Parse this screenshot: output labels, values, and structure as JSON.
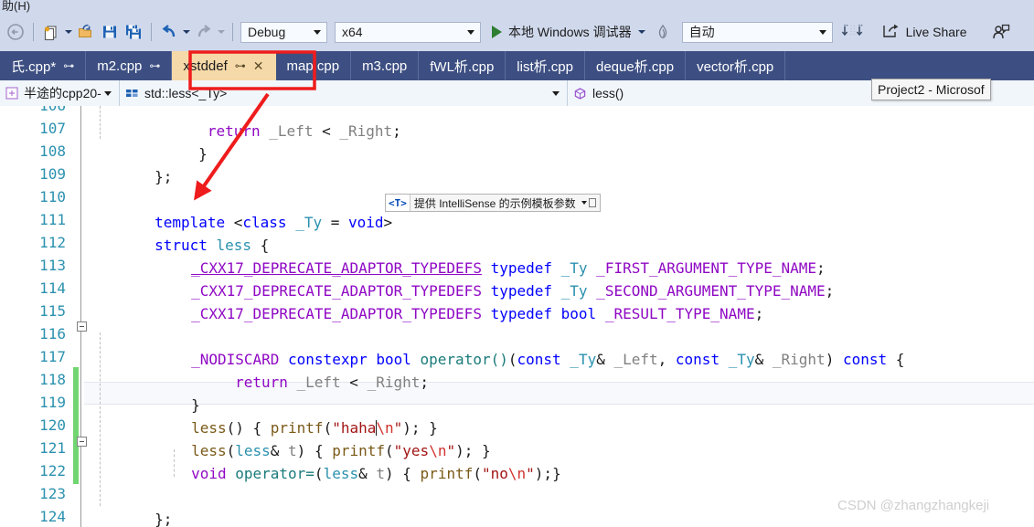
{
  "window": {
    "menu_tail_label": "助(H)",
    "tooltip": "Project2 - Microsof"
  },
  "toolbar": {
    "nav_back_icon": "navigate-back-icon",
    "new_item_icon": "new-item-icon",
    "open_icon": "open-file-icon",
    "save_icon": "save-icon",
    "save_all_icon": "save-all-icon",
    "undo_icon": "undo-icon",
    "redo_icon": "redo-icon",
    "config": "Debug",
    "platform": "x64",
    "run_label": "本地 Windows 调试器",
    "hotreload_icon": "hot-reload-icon",
    "auto_label": "自动",
    "layout_icon": "window-layout-icon",
    "live_share_label": "Live Share",
    "live_share_icon": "live-share-icon",
    "feedback_icon": "send-feedback-icon"
  },
  "tabs": [
    {
      "label": "氏.cpp*",
      "pin": "⊶",
      "active": false,
      "closable": false
    },
    {
      "label": "m2.cpp",
      "pin": "⊶",
      "active": false,
      "closable": false
    },
    {
      "label": "xstddef",
      "pin": "⊶",
      "active": true,
      "closable": true,
      "close": "✕"
    },
    {
      "label": "map.cpp",
      "pin": "",
      "active": false,
      "closable": false
    },
    {
      "label": "m3.cpp",
      "pin": "",
      "active": false,
      "closable": false
    },
    {
      "label": "fWL析.cpp",
      "pin": "",
      "active": false,
      "closable": false
    },
    {
      "label": "list析.cpp",
      "pin": "",
      "active": false,
      "closable": false
    },
    {
      "label": "deque析.cpp",
      "pin": "",
      "active": false,
      "closable": false
    },
    {
      "label": "vector析.cpp",
      "pin": "",
      "active": false,
      "closable": false
    }
  ],
  "navbar": {
    "project": "半途的cpp20-",
    "project_icon": "project-icon",
    "type": "std::less<_Ty>",
    "type_icon": "struct-icon",
    "member": "less()",
    "member_icon": "method-icon"
  },
  "editor": {
    "first_partial_line": "106",
    "lines": [
      {
        "num": "107"
      },
      {
        "num": "108"
      },
      {
        "num": "109"
      },
      {
        "num": "110"
      },
      {
        "num": "111"
      },
      {
        "num": "112"
      },
      {
        "num": "113"
      },
      {
        "num": "114"
      },
      {
        "num": "115"
      },
      {
        "num": "116"
      },
      {
        "num": "117"
      },
      {
        "num": "118"
      },
      {
        "num": "119"
      },
      {
        "num": "120"
      },
      {
        "num": "121"
      },
      {
        "num": "122"
      },
      {
        "num": "123"
      },
      {
        "num": "124"
      }
    ],
    "code": {
      "l106_partial": "return _Left < _Right;",
      "l107": "}",
      "l108": "};",
      "l110_template": "template",
      "l110_open": " <",
      "l110_class": "class",
      "l110_ty": " _Ty",
      "l110_eq": " = ",
      "l110_void": "void",
      "l110_close": ">",
      "l111_struct": "struct",
      "l111_name": " less",
      "l111_brace": " {",
      "l112_macro": "_CXX17_DEPRECATE_ADAPTOR_TYPEDEFS",
      "l112_typedef": " typedef",
      "l112_ty": " _Ty",
      "l112_name": " _FIRST_ARGUMENT_TYPE_NAME",
      "l112_semi": ";",
      "l113_macro": "_CXX17_DEPRECATE_ADAPTOR_TYPEDEFS",
      "l113_typedef": " typedef",
      "l113_ty": " _Ty",
      "l113_name": " _SECOND_ARGUMENT_TYPE_NAME",
      "l113_semi": ";",
      "l114_macro": "_CXX17_DEPRECATE_ADAPTOR_TYPEDEFS",
      "l114_typedef": " typedef",
      "l114_bool": " bool",
      "l114_name": " _RESULT_TYPE_NAME",
      "l114_semi": ";",
      "l116_nodiscard": "_NODISCARD",
      "l116_constexpr": " constexpr",
      "l116_bool": " bool",
      "l116_operator": " operator()",
      "l116_p1": "(",
      "l116_const1": "const",
      "l116_ty1": " _Ty",
      "l116_amp1": "&",
      "l116_left": " _Left",
      "l116_comma": ", ",
      "l116_const2": "const",
      "l116_ty2": " _Ty",
      "l116_amp2": "&",
      "l116_right": " _Right",
      "l116_p2": ")",
      "l116_const3": " const",
      "l116_brace": " {",
      "l117_return": "return",
      "l117_left": " _Left",
      "l117_lt": " < ",
      "l117_right": "_Right",
      "l117_semi": ";",
      "l118": "}",
      "l119_ctor": "less",
      "l119_parens": "()",
      "l119_open": " { ",
      "l119_printf": "printf",
      "l119_p1": "(",
      "l119_strq": "\"haha",
      "l119_esc": "\\n",
      "l119_strend": "\"",
      "l119_tail": "); }",
      "l120_ctor": "less",
      "l120_p1": "(",
      "l120_type": "less",
      "l120_amp": "&",
      "l120_param": " t",
      "l120_p2": ")",
      "l120_open": " { ",
      "l120_printf": "printf",
      "l120_op": "(",
      "l120_strq": "\"yes",
      "l120_esc": "\\n",
      "l120_strend": "\"",
      "l120_tail": "); }",
      "l121_void": "void",
      "l121_operator": " operator=",
      "l121_p1": "(",
      "l121_type": "less",
      "l121_amp": "&",
      "l121_param": " t",
      "l121_p2": ")",
      "l121_open": " { ",
      "l121_printf": "printf",
      "l121_op": "(",
      "l121_strq": "\"no",
      "l121_esc": "\\n",
      "l121_strend": "\"",
      "l121_tail": ");}",
      "l123": "};"
    },
    "template_hint": {
      "badge": "<T>",
      "text": "提供 IntelliSense 的示例模板参数"
    }
  },
  "annotation": {
    "box_color": "#ee1c1c",
    "arrow_color": "#ee1c1c"
  },
  "watermark": "CSDN @zhangzhangkeji"
}
